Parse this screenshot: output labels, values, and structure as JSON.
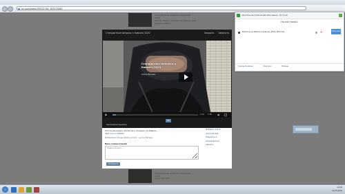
{
  "browser": {
    "address": "vk.com/video130521746_163272849"
  },
  "background": {
    "item_title": "Стандартные вопросы к Кавказу 2020",
    "item_author": "Антон Евтеев",
    "item_lines": [
      "Метод: Видео/ дорожные каналы для Кавказа 2020 г.",
      "Антон Евтеев"
    ]
  },
  "modal": {
    "header_title": "Стандартные вопросы к Кавказу 2020",
    "header_links": [
      "Закрыть",
      "Свернуть"
    ],
    "video_title": "Стандартные вопросы к Кавказу 2020",
    "video_author": "Антон Евтеев",
    "time_current": "0:14",
    "time_total": "5:38",
    "progress": 0.04,
    "quality": "HD",
    "comment_link": "Закомментировать",
    "description": "Описание видео: вопросы к поездке на Кавказ ...",
    "description_link": "http://vk.cc/ad9xQ",
    "meta": "Добавлено 16 мая 2020 в 12:24 · Антон Евтеев",
    "comment_label": "Ваш комментарий",
    "comment_placeholder": "Комментировать...",
    "submit_label": "Отправить",
    "side_links": [
      "Добавить в мои",
      "Антон Евтеев",
      "Поделиться",
      "Пожаловаться",
      "Удалить"
    ]
  },
  "popup": {
    "notice": "About this launched private time session. Try it out!",
    "found_label": "Found media:",
    "media_file": "Вопросы на Кавказ к Кавказу_2020_360.mp4",
    "download_label": "Download",
    "footer": [
      "Сохранить видео",
      "Загрузки",
      "Помощь"
    ]
  },
  "taskbar": {
    "clock_time": "12:44",
    "clock_date": "16.05.2020"
  },
  "colors": {
    "accent": "#5b7fa6",
    "download": "#4d8fd3",
    "remove": "#c02020",
    "popup_ok": "#2f9a38"
  }
}
